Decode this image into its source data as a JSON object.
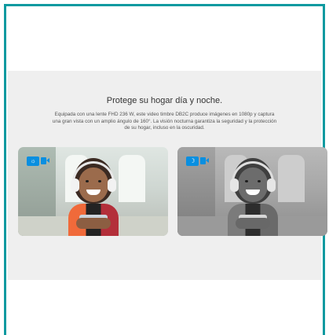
{
  "section": {
    "title": "Protege su hogar día y noche.",
    "description": "Equipada con una lente FHD 236 W, este video timbre DB2C produce imágenes en 1080p y captura una gran vista con un amplio ángulo de 160°. La visión nocturna garantiza la seguridad y la protección de su hogar, incluso en la oscuridad."
  },
  "cards": [
    {
      "mode": "day",
      "icon": "sun-icon",
      "glyph": "☼"
    },
    {
      "mode": "night",
      "icon": "moon-icon",
      "glyph": "☽"
    }
  ],
  "colors": {
    "frame_border": "#0c9aa0",
    "section_bg": "#efefef",
    "badge": "#0a8fe0"
  }
}
